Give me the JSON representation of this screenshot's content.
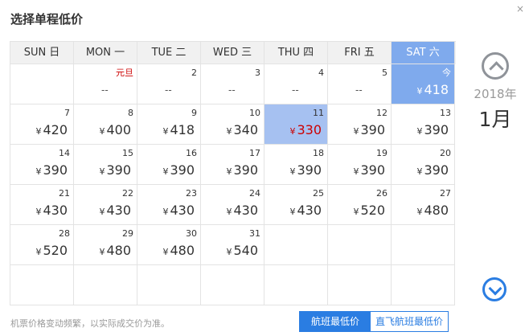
{
  "title": "选择单程低价",
  "close_glyph": "×",
  "weekdays": [
    "SUN 日",
    "MON 一",
    "TUE 二",
    "WED 三",
    "THU 四",
    "FRI 五",
    "SAT 六"
  ],
  "currency": "¥",
  "rows": [
    [
      {
        "day": "",
        "price": ""
      },
      {
        "day": "元旦",
        "price": "--",
        "holiday": true
      },
      {
        "day": "2",
        "price": "--"
      },
      {
        "day": "3",
        "price": "--"
      },
      {
        "day": "4",
        "price": "--"
      },
      {
        "day": "5",
        "price": "--"
      },
      {
        "day": "今",
        "price": "418",
        "today": true
      }
    ],
    [
      {
        "day": "7",
        "price": "420"
      },
      {
        "day": "8",
        "price": "400"
      },
      {
        "day": "9",
        "price": "418"
      },
      {
        "day": "10",
        "price": "340"
      },
      {
        "day": "11",
        "price": "330",
        "selected": true
      },
      {
        "day": "12",
        "price": "390"
      },
      {
        "day": "13",
        "price": "390"
      }
    ],
    [
      {
        "day": "14",
        "price": "390"
      },
      {
        "day": "15",
        "price": "390"
      },
      {
        "day": "16",
        "price": "390"
      },
      {
        "day": "17",
        "price": "390"
      },
      {
        "day": "18",
        "price": "390"
      },
      {
        "day": "19",
        "price": "390"
      },
      {
        "day": "20",
        "price": "390"
      }
    ],
    [
      {
        "day": "21",
        "price": "430"
      },
      {
        "day": "22",
        "price": "430"
      },
      {
        "day": "23",
        "price": "430"
      },
      {
        "day": "24",
        "price": "430"
      },
      {
        "day": "25",
        "price": "430"
      },
      {
        "day": "26",
        "price": "520"
      },
      {
        "day": "27",
        "price": "480"
      }
    ],
    [
      {
        "day": "28",
        "price": "520"
      },
      {
        "day": "29",
        "price": "480"
      },
      {
        "day": "30",
        "price": "480"
      },
      {
        "day": "31",
        "price": "540"
      },
      {
        "day": "",
        "price": ""
      },
      {
        "day": "",
        "price": ""
      },
      {
        "day": "",
        "price": ""
      }
    ],
    [
      {
        "day": "",
        "price": ""
      },
      {
        "day": "",
        "price": ""
      },
      {
        "day": "",
        "price": ""
      },
      {
        "day": "",
        "price": ""
      },
      {
        "day": "",
        "price": ""
      },
      {
        "day": "",
        "price": ""
      },
      {
        "day": "",
        "price": ""
      }
    ]
  ],
  "side": {
    "year": "2018年",
    "month": "1月"
  },
  "footer": {
    "note": "机票价格变动频繁，以实际成交价为准。",
    "tab_lowest": "航班最低价",
    "tab_direct": "直飞航班最低价"
  },
  "colors": {
    "accent": "#2a7de2",
    "today_bg": "#7faaed",
    "selected_bg": "#a6c1f1",
    "holiday": "#cc0000"
  }
}
